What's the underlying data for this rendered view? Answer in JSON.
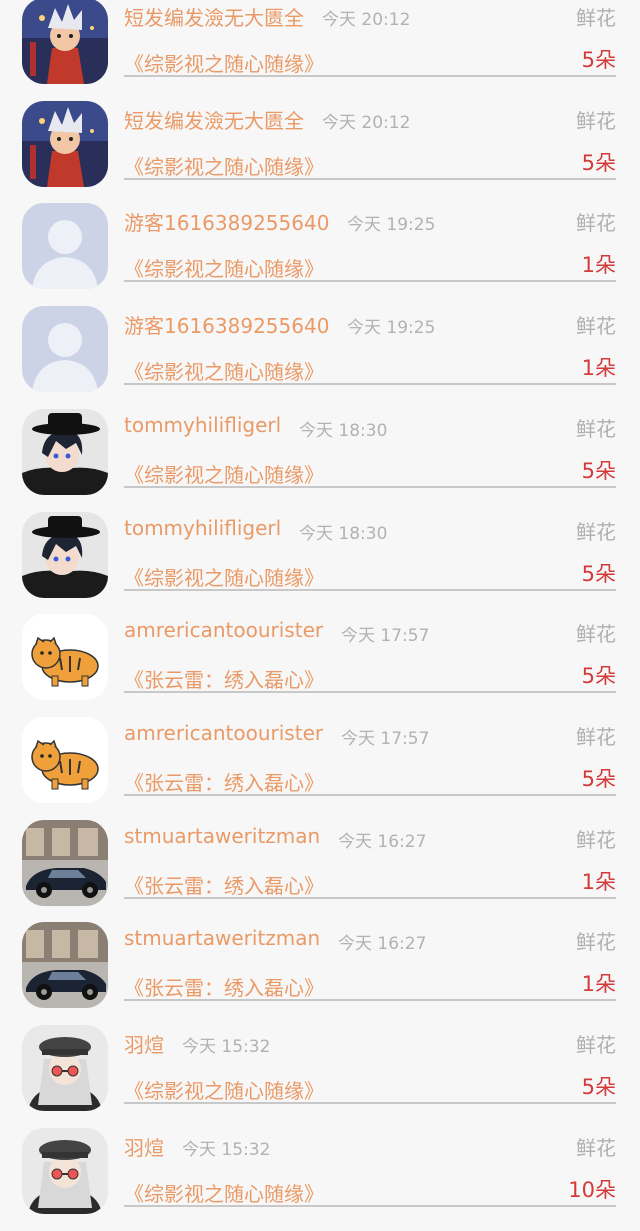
{
  "gift_records": [
    {
      "user": "短发编发澰无大匮全",
      "time": "今天 20:12",
      "gift_type": "鲜花",
      "work": "《综影视之随心随缘》",
      "count": "5朵",
      "avatar": "warrior"
    },
    {
      "user": "短发编发澰无大匮全",
      "time": "今天 20:12",
      "gift_type": "鲜花",
      "work": "《综影视之随心随缘》",
      "count": "5朵",
      "avatar": "warrior"
    },
    {
      "user": "游客1616389255640",
      "time": "今天 19:25",
      "gift_type": "鲜花",
      "work": "《综影视之随心随缘》",
      "count": "1朵",
      "avatar": "default"
    },
    {
      "user": "游客1616389255640",
      "time": "今天 19:25",
      "gift_type": "鲜花",
      "work": "《综影视之随心随缘》",
      "count": "1朵",
      "avatar": "default"
    },
    {
      "user": "tommyhilifligerl",
      "time": "今天 18:30",
      "gift_type": "鲜花",
      "work": "《综影视之随心随缘》",
      "count": "5朵",
      "avatar": "anime-hat"
    },
    {
      "user": "tommyhilifligerl",
      "time": "今天 18:30",
      "gift_type": "鲜花",
      "work": "《综影视之随心随缘》",
      "count": "5朵",
      "avatar": "anime-hat"
    },
    {
      "user": "amrericantoourister",
      "time": "今天 17:57",
      "gift_type": "鲜花",
      "work": "《张云雷：绣入磊心》",
      "count": "5朵",
      "avatar": "tiger"
    },
    {
      "user": "amrericantoourister",
      "time": "今天 17:57",
      "gift_type": "鲜花",
      "work": "《张云雷：绣入磊心》",
      "count": "5朵",
      "avatar": "tiger"
    },
    {
      "user": "stmuartaweritzman",
      "time": "今天 16:27",
      "gift_type": "鲜花",
      "work": "《张云雷：绣入磊心》",
      "count": "1朵",
      "avatar": "car"
    },
    {
      "user": "stmuartaweritzman",
      "time": "今天 16:27",
      "gift_type": "鲜花",
      "work": "《张云雷：绣入磊心》",
      "count": "1朵",
      "avatar": "car"
    },
    {
      "user": "羽煊",
      "time": "今天 15:32",
      "gift_type": "鲜花",
      "work": "《综影视之随心随缘》",
      "count": "5朵",
      "avatar": "girl-cap"
    },
    {
      "user": "羽煊",
      "time": "今天 15:32",
      "gift_type": "鲜花",
      "work": "《综影视之随心随缘》",
      "count": "10朵",
      "avatar": "girl-cap"
    }
  ]
}
